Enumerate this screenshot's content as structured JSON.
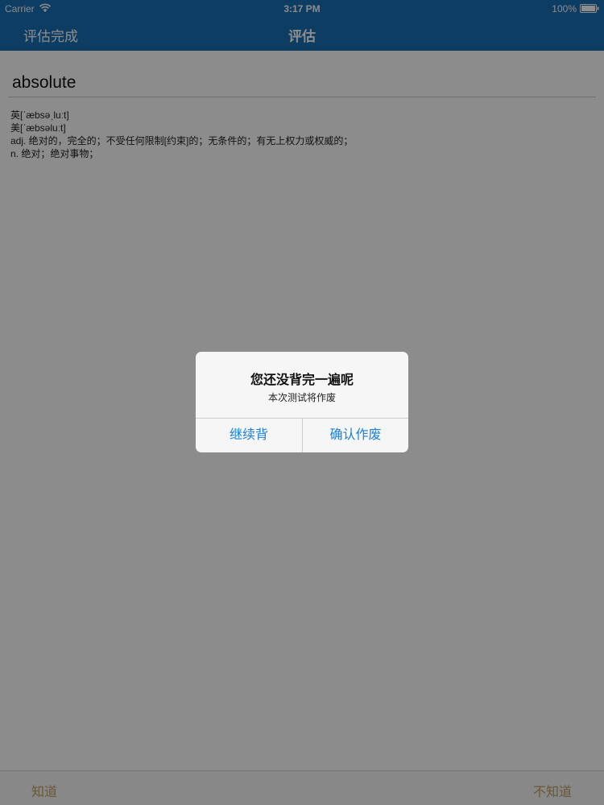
{
  "status_bar": {
    "carrier": "Carrier",
    "time": "3:17 PM",
    "battery": "100%",
    "wifi_icon": "wifi-icon",
    "battery_icon": "battery-icon"
  },
  "nav_bar": {
    "left_button": "评估完成",
    "title": "评估",
    "background_color": "#1a6fb5"
  },
  "word_card": {
    "word": "absolute",
    "lines": [
      "英[ˈæbsəˌluːt]",
      "美[ˈæbsəluːt]",
      "adj. 绝对的，完全的；不受任何限制[约束]的；无条件的；有无上权力或权威的；",
      "n. 绝对；绝对事物；"
    ]
  },
  "toolbar": {
    "know_label": "知道",
    "dont_know_label": "不知道"
  },
  "alert": {
    "title": "您还没背完一遍呢",
    "message": "本次测试将作废",
    "continue_label": "继续背",
    "confirm_label": "确认作废",
    "button_color": "#1a7fd6"
  }
}
